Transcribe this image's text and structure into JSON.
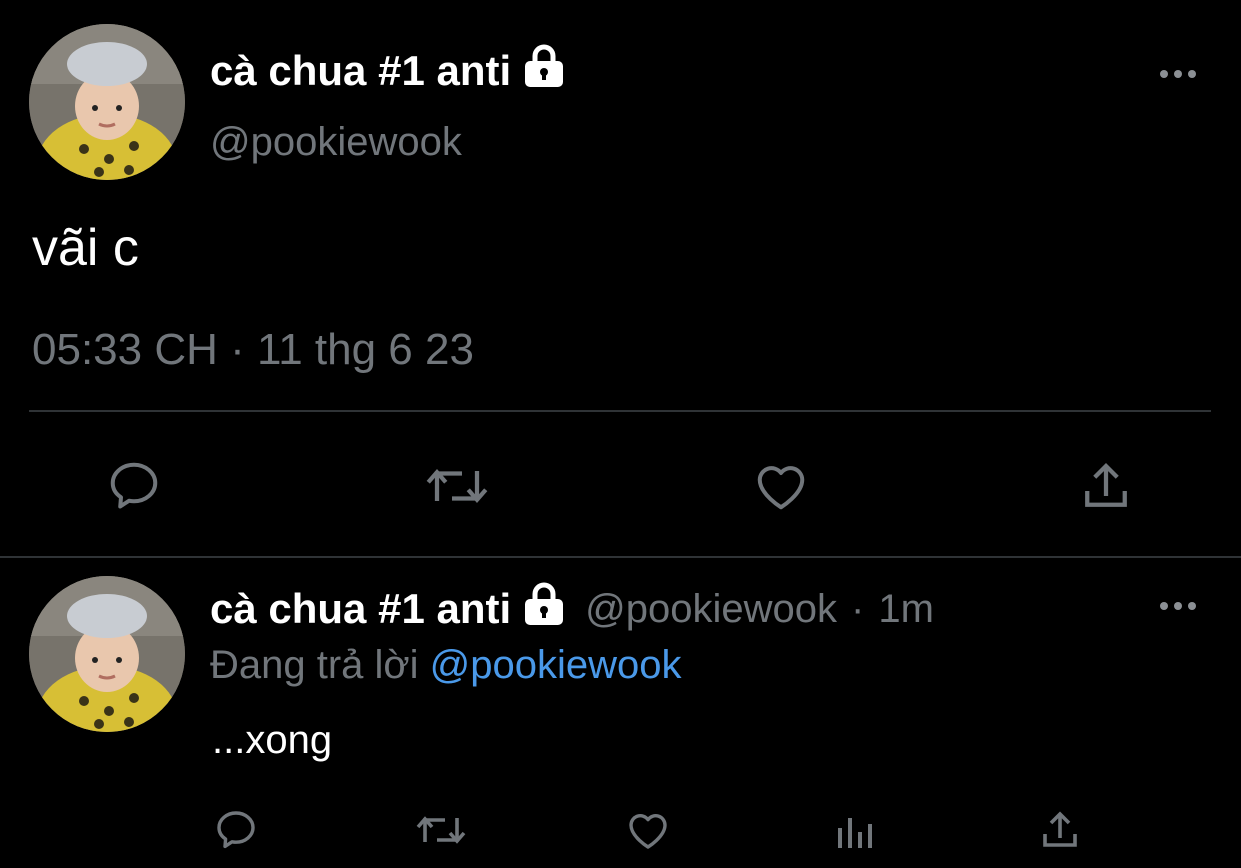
{
  "main_tweet": {
    "display_name": "cà chua #1 anti",
    "handle": "@pookiewook",
    "text": "vãi c",
    "timestamp": "05:33 CH · 11 thg 6 23",
    "actions": [
      "reply-icon",
      "retweet-icon",
      "like-icon",
      "share-icon"
    ]
  },
  "reply_tweet": {
    "display_name": "cà chua #1 anti",
    "handle": "@pookiewook",
    "separator": "·",
    "time_ago": "1m",
    "replying_label": "Đang trả lời",
    "replying_to": "@pookiewook",
    "text": "...xong",
    "actions": [
      "reply-icon",
      "retweet-icon",
      "like-icon",
      "analytics-icon",
      "share-icon"
    ]
  },
  "colors": {
    "background": "#000000",
    "text": "#e7e9ea",
    "muted": "#71767b",
    "link": "#4a99e9",
    "divider": "#2f3336"
  }
}
